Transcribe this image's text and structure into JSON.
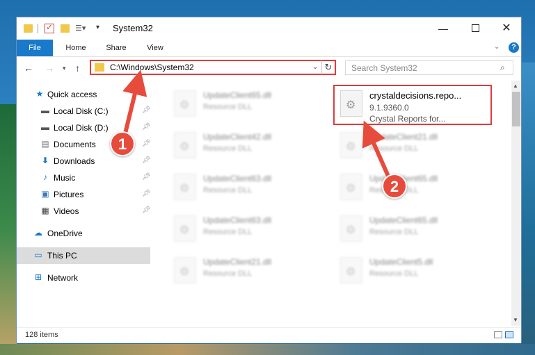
{
  "window": {
    "title": "System32",
    "buttons": {
      "minimize": "—",
      "maximize": "",
      "close": "✕"
    }
  },
  "ribbon": {
    "tabs": [
      {
        "label": "File"
      },
      {
        "label": "Home"
      },
      {
        "label": "Share"
      },
      {
        "label": "View"
      }
    ],
    "help": "?"
  },
  "navbar": {
    "address": "C:\\Windows\\System32",
    "search_placeholder": "Search System32"
  },
  "sidebar": {
    "items": [
      {
        "label": "Quick access",
        "icon": "star-icon"
      },
      {
        "label": "Local Disk (C:)",
        "icon": "drive-icon"
      },
      {
        "label": "Local Disk (D:)",
        "icon": "drive-icon"
      },
      {
        "label": "Documents",
        "icon": "documents-icon"
      },
      {
        "label": "Downloads",
        "icon": "download-arrow-icon"
      },
      {
        "label": "Music",
        "icon": "music-icon"
      },
      {
        "label": "Pictures",
        "icon": "pictures-icon"
      },
      {
        "label": "Videos",
        "icon": "videos-icon"
      },
      {
        "label": "OneDrive",
        "icon": "cloud-icon"
      },
      {
        "label": "This PC",
        "icon": "computer-icon"
      },
      {
        "label": "Network",
        "icon": "network-icon"
      }
    ]
  },
  "files": {
    "highlighted": {
      "name": "crystaldecisions.repo...",
      "version": "9.1.9360.0",
      "description": "Crystal Reports for..."
    },
    "blurred": [
      {
        "name": "UpdateClient65.dll",
        "type": "Resource DLL"
      },
      {
        "name": "UpdateClient42.dll",
        "type": "Resource DLL"
      },
      {
        "name": "UpdateClient21.dll",
        "type": "Resource DLL"
      },
      {
        "name": "UpdateClient63.dll",
        "type": "Resource DLL"
      },
      {
        "name": "UpdateClient65.dll",
        "type": "Resource DLL"
      },
      {
        "name": "UpdateClient63.dll",
        "type": "Resource DLL"
      },
      {
        "name": "UpdateClient65.dll",
        "type": "Resource DLL"
      },
      {
        "name": "UpdateClient21.dll",
        "type": "Resource DLL"
      },
      {
        "name": "UpdateClient5.dll",
        "type": "Resource DLL"
      }
    ]
  },
  "status": {
    "item_count": "128 items"
  },
  "annotations": {
    "step1": "1",
    "step2": "2",
    "color": "#e74b3c"
  }
}
